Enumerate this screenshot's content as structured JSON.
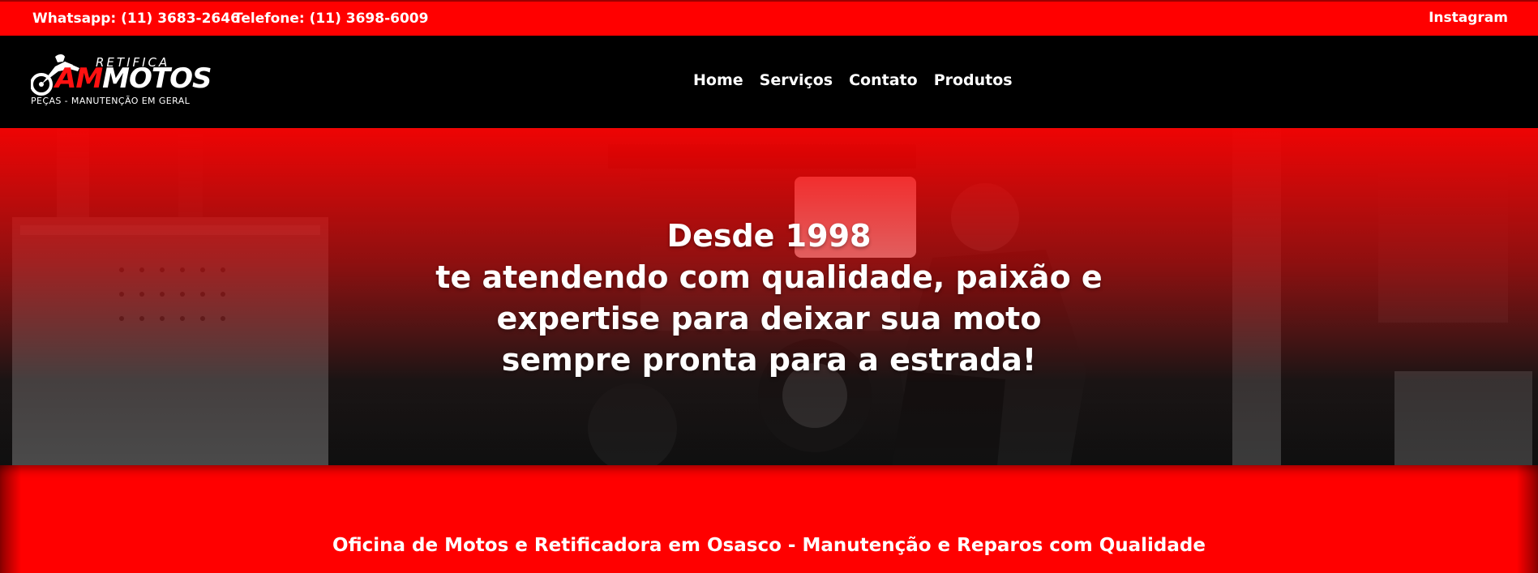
{
  "topbar": {
    "whatsapp": "Whatsapp: (11) 3683-2646",
    "phone": "Telefone: (11) 3698-6009",
    "instagram": "Instagram"
  },
  "logo": {
    "retifica": "RETIFICA",
    "brand_am": "AM",
    "brand_motos": "MOTOS",
    "subtitle": "PEÇAS - MANUTENÇÃO EM GERAL",
    "icon": "motorcycle-icon"
  },
  "nav": {
    "items": [
      {
        "label": "Home"
      },
      {
        "label": "Serviços"
      },
      {
        "label": "Contato"
      },
      {
        "label": "Produtos"
      }
    ]
  },
  "hero": {
    "line1": "Desde 1998",
    "line2": "te atendendo com qualidade, paixão e expertise para deixar sua moto sempre pronta para a estrada!"
  },
  "section": {
    "title": "Oficina de Motos e Retificadora em Osasco - Manutenção e Reparos com Qualidade"
  },
  "colors": {
    "brand_red": "#ff0000",
    "nav_bg": "#000000",
    "text": "#ffffff"
  }
}
